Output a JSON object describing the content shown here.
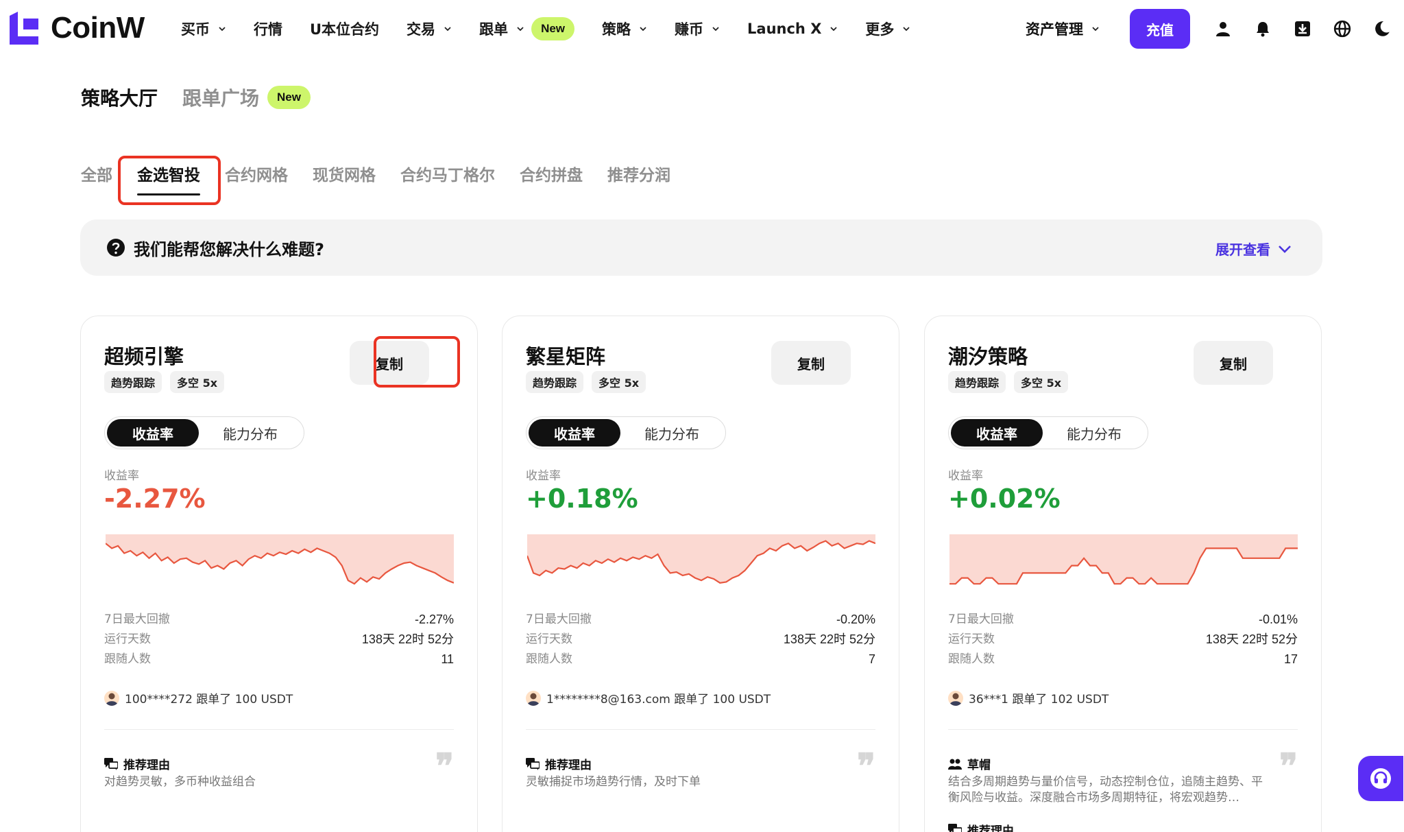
{
  "brand": {
    "name": "CoinW",
    "accent": "#5b2df5",
    "new_badge_color": "#cdf56b"
  },
  "nav": {
    "menu": [
      {
        "label": "买币",
        "dropdown": true
      },
      {
        "label": "行情",
        "dropdown": false
      },
      {
        "label": "U本位合约",
        "dropdown": false
      },
      {
        "label": "交易",
        "dropdown": true
      },
      {
        "label": "跟单",
        "dropdown": true,
        "badge": "New"
      },
      {
        "label": "策略",
        "dropdown": true
      },
      {
        "label": "赚币",
        "dropdown": true
      },
      {
        "label": "Launch X",
        "dropdown": true
      },
      {
        "label": "更多",
        "dropdown": true
      }
    ],
    "asset_label": "资产管理",
    "deposit_label": "充值",
    "icons": [
      "user-icon",
      "bell-icon",
      "download-icon",
      "globe-icon",
      "moon-icon"
    ]
  },
  "page": {
    "tab_active": "策略大厅",
    "tab_other": "跟单广场",
    "tab_other_badge": "New"
  },
  "sub_tabs": [
    "全部",
    "金选智投",
    "合约网格",
    "现货网格",
    "合约马丁格尔",
    "合约拼盘",
    "推荐分润"
  ],
  "sub_tab_active": "金选智投",
  "help": {
    "question": "我们能帮您解决什么难题?",
    "expand": "展开查看"
  },
  "cards": [
    {
      "title": "超频引擎",
      "tags": [
        "趋势跟踪",
        "多空 5x"
      ],
      "copy": "复制",
      "seg_on": "收益率",
      "seg_off": "能力分布",
      "metric_label": "收益率",
      "metric_value": "-2.27%",
      "trend": "negative",
      "stats": [
        {
          "k": "7日最大回撤",
          "v": "-2.27%"
        },
        {
          "k": "运行天数",
          "v": "138天 22时 52分"
        },
        {
          "k": "跟随人数",
          "v": "11"
        }
      ],
      "follow": "100****272 跟单了 100 USDT",
      "reason_title": "推荐理由",
      "reason_text": "对趋势灵敏，多币种收益组合",
      "curve": [
        0.1,
        0.2,
        0.15,
        0.3,
        0.25,
        0.35,
        0.28,
        0.4,
        0.3,
        0.45,
        0.38,
        0.5,
        0.42,
        0.4,
        0.48,
        0.52,
        0.45,
        0.6,
        0.55,
        0.62,
        0.5,
        0.45,
        0.55,
        0.42,
        0.35,
        0.4,
        0.3,
        0.35,
        0.28,
        0.32,
        0.25,
        0.3,
        0.22,
        0.28,
        0.2,
        0.25,
        0.3,
        0.38,
        0.55,
        0.85,
        0.92,
        0.8,
        0.88,
        0.78,
        0.82,
        0.7,
        0.62,
        0.55,
        0.5,
        0.48,
        0.55,
        0.6,
        0.65,
        0.7,
        0.78,
        0.85,
        0.9
      ]
    },
    {
      "title": "繁星矩阵",
      "tags": [
        "趋势跟踪",
        "多空 5x"
      ],
      "copy": "复制",
      "seg_on": "收益率",
      "seg_off": "能力分布",
      "metric_label": "收益率",
      "metric_value": "+0.18%",
      "trend": "positive",
      "stats": [
        {
          "k": "7日最大回撤",
          "v": "-0.20%"
        },
        {
          "k": "运行天数",
          "v": "138天 22时 52分"
        },
        {
          "k": "跟随人数",
          "v": "7"
        }
      ],
      "follow": "1********8@163.com 跟单了 100 USDT",
      "reason_title": "推荐理由",
      "reason_text": "灵敏捕捉市场趋势行情，及时下单",
      "curve": [
        0.35,
        0.7,
        0.75,
        0.65,
        0.7,
        0.6,
        0.62,
        0.55,
        0.6,
        0.5,
        0.55,
        0.45,
        0.5,
        0.42,
        0.48,
        0.4,
        0.45,
        0.38,
        0.42,
        0.35,
        0.4,
        0.32,
        0.55,
        0.7,
        0.68,
        0.75,
        0.72,
        0.8,
        0.85,
        0.78,
        0.82,
        0.9,
        0.88,
        0.8,
        0.75,
        0.65,
        0.5,
        0.35,
        0.3,
        0.2,
        0.25,
        0.15,
        0.1,
        0.2,
        0.15,
        0.25,
        0.18,
        0.1,
        0.05,
        0.15,
        0.1,
        0.2,
        0.15,
        0.1,
        0.12,
        0.05,
        0.1
      ]
    },
    {
      "title": "潮汐策略",
      "tags": [
        "趋势跟踪",
        "多空 5x"
      ],
      "copy": "复制",
      "seg_on": "收益率",
      "seg_off": "能力分布",
      "metric_label": "收益率",
      "metric_value": "+0.02%",
      "trend": "positive",
      "stats": [
        {
          "k": "7日最大回撤",
          "v": "-0.01%"
        },
        {
          "k": "运行天数",
          "v": "138天 22时 52分"
        },
        {
          "k": "跟随人数",
          "v": "17"
        }
      ],
      "follow": "36***1 跟单了 102 USDT",
      "reason_title": "草帽",
      "reason_text": "结合多周期趋势与量价信号，动态控制仓位，追随主趋势、平衡风险与收益。深度融合市场多周期特征，将宏观趋势…",
      "reason_title_2": "推荐理由",
      "curve": [
        0.92,
        0.92,
        0.8,
        0.8,
        0.92,
        0.92,
        0.8,
        0.8,
        0.92,
        0.92,
        0.92,
        0.92,
        0.7,
        0.7,
        0.7,
        0.7,
        0.7,
        0.7,
        0.7,
        0.7,
        0.55,
        0.55,
        0.4,
        0.55,
        0.55,
        0.7,
        0.7,
        0.92,
        0.92,
        0.8,
        0.8,
        0.92,
        0.92,
        0.8,
        0.92,
        0.92,
        0.92,
        0.92,
        0.92,
        0.92,
        0.7,
        0.4,
        0.2,
        0.2,
        0.2,
        0.2,
        0.2,
        0.2,
        0.4,
        0.4,
        0.4,
        0.4,
        0.4,
        0.4,
        0.4,
        0.2,
        0.2,
        0.2
      ]
    }
  ]
}
